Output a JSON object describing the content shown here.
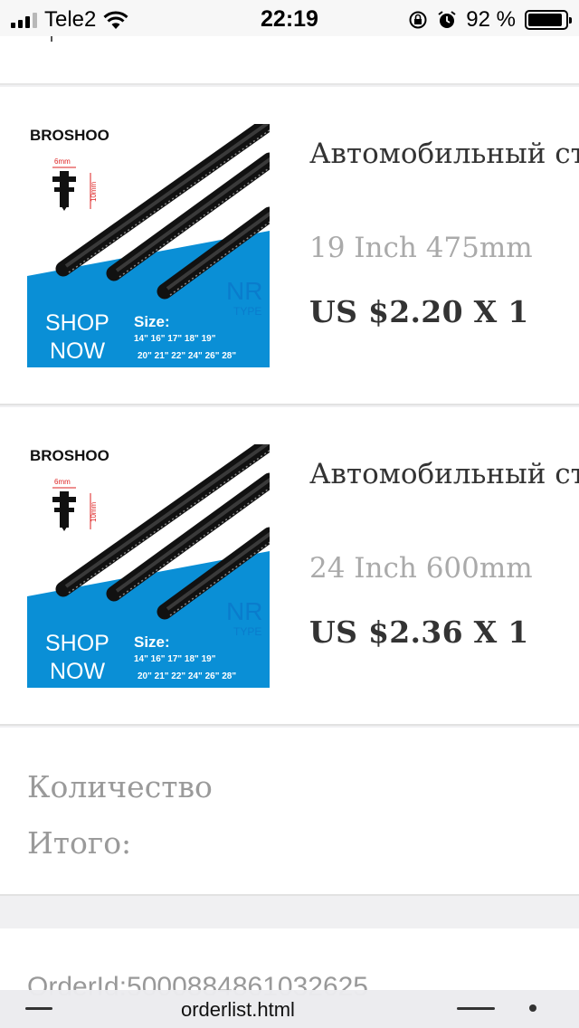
{
  "status_bar": {
    "carrier": "Tele2",
    "time": "22:19",
    "battery_percent": "92 %",
    "battery_level": 0.92,
    "icons": [
      "signal-icon",
      "wifi-icon",
      "rotation-lock-icon",
      "alarm-icon",
      "battery-icon"
    ]
  },
  "products": [
    {
      "title": "Автомобильный стеклоочиститель и",
      "variant": "19 Inch 475mm",
      "price": "US $2.20 X 1",
      "image": {
        "brand": "BROSHOO",
        "dim_width": "6mm",
        "dim_height": "10mm",
        "type_big": "NR",
        "type_small": "TYPE",
        "shop": "SHOP",
        "now": "NOW",
        "size_label": "Size:",
        "sizes_1": "14\" 16\" 17\" 18\" 19\"",
        "sizes_2": "20\" 21\" 22\" 24\" 26\" 28\""
      }
    },
    {
      "title": "Автомобильный стеклоочиститель и",
      "variant": "24 Inch 600mm",
      "price": "US $2.36 X 1",
      "image": {
        "brand": "BROSHOO",
        "dim_width": "6mm",
        "dim_height": "10mm",
        "type_big": "NR",
        "type_small": "TYPE",
        "shop": "SHOP",
        "now": "NOW",
        "size_label": "Size:",
        "sizes_1": "14\" 16\" 17\" 18\" 19\"",
        "sizes_2": "20\" 21\" 22\" 24\" 26\" 28\""
      }
    }
  ],
  "summary": {
    "quantity_label": "Количество",
    "total_label": "Итого:"
  },
  "order": {
    "id_text": "OrderId:5000884861032625"
  },
  "browser": {
    "url": "orderlist.html"
  },
  "colors": {
    "banner_blue": "#0a8fd6",
    "price_text": "#333333",
    "muted_text": "#9a9a9a"
  }
}
